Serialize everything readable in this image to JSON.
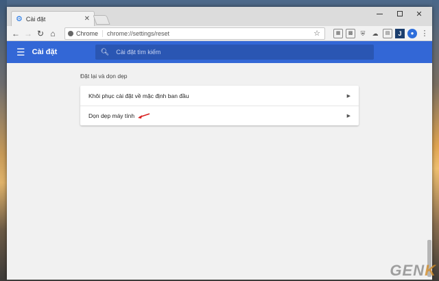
{
  "tab": {
    "title": "Cài đặt",
    "close": "✕"
  },
  "window": {
    "minimize": "",
    "maximize": "",
    "close": "✕"
  },
  "omnibox": {
    "chip_label": "Chrome",
    "url": "chrome://settings/reset"
  },
  "header": {
    "title": "Cài đặt",
    "search_placeholder": "Cài đặt tìm kiếm"
  },
  "section": {
    "title": "Đặt lại và dọn dẹp"
  },
  "rows": [
    {
      "label": "Khôi phục cài đặt về mặc định ban đầu"
    },
    {
      "label": "Dọn dẹp máy tính"
    }
  ],
  "watermark": {
    "text": "GEN",
    "accent": "K"
  },
  "colors": {
    "header_bg": "#3367d6",
    "search_bg": "#2a56b3",
    "accent": "#1a73e8"
  }
}
